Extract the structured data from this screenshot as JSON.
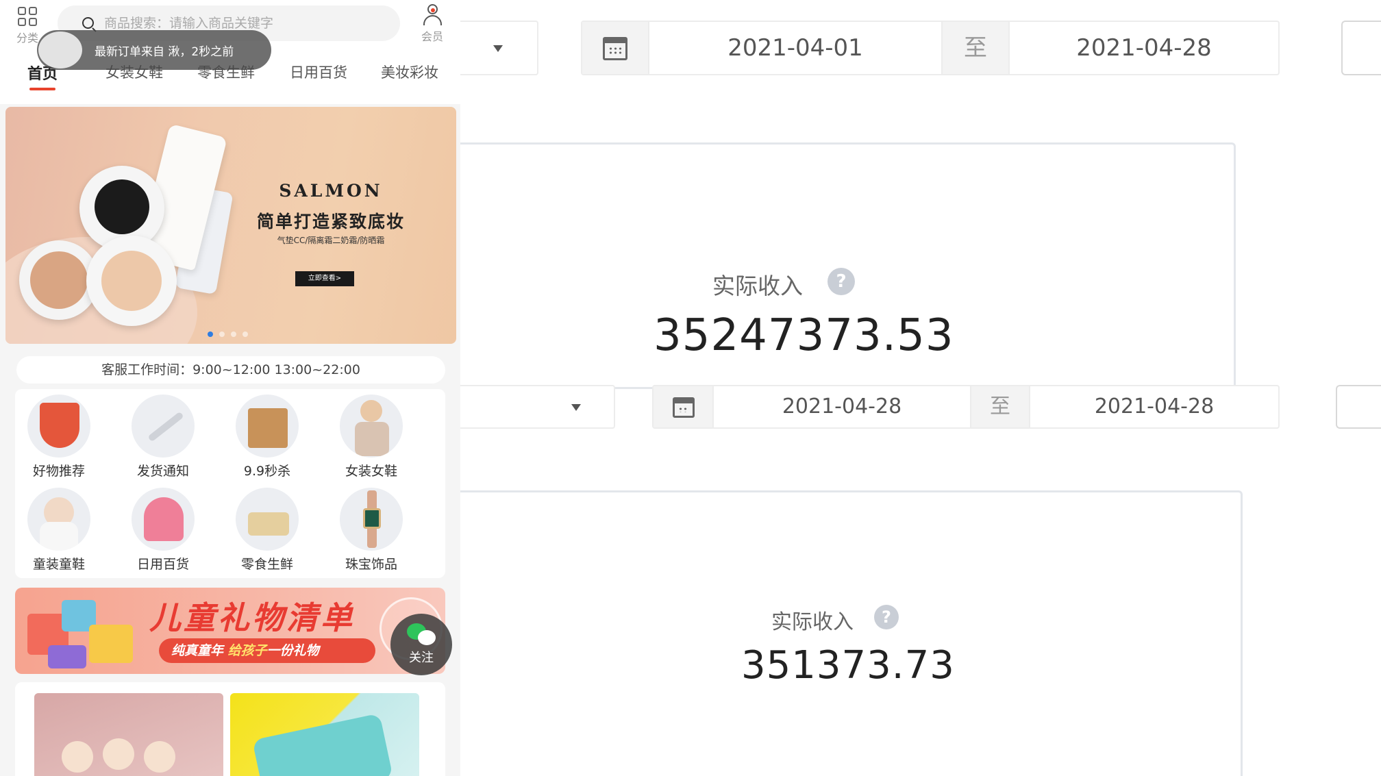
{
  "app": {
    "category_label": "分类",
    "member_label": "会员",
    "search": {
      "placeholder": "商品搜索：请输入商品关键字"
    },
    "order_toast": "最新订单来自 湫，2秒之前",
    "tabs": [
      {
        "label": "首页",
        "active": true
      },
      {
        "label": "女装女鞋",
        "active": false
      },
      {
        "label": "零食生鲜",
        "active": false
      },
      {
        "label": "日用百货",
        "active": false
      },
      {
        "label": "美妆彩妆",
        "active": false
      }
    ],
    "banner": {
      "brand": "SALMON",
      "headline": "简单打造紧致底妆",
      "subtitle": "气垫CC/隔离霜二奶霜/防晒霜",
      "cta": "立即查看>",
      "slide_count": 4,
      "active_slide": 1
    },
    "service_hours": "客服工作时间：9:00~12:00  13:00~22:00",
    "categories": [
      {
        "label": "好物推荐",
        "icon": "gift-box-icon"
      },
      {
        "label": "发货通知",
        "icon": "shipping-icon"
      },
      {
        "label": "9.9秒杀",
        "icon": "flash-sale-icon"
      },
      {
        "label": "女装女鞋",
        "icon": "womens-wear-icon"
      },
      {
        "label": "童装童鞋",
        "icon": "kids-wear-icon"
      },
      {
        "label": "日用百货",
        "icon": "umbrella-icon"
      },
      {
        "label": "零食生鲜",
        "icon": "snack-icon"
      },
      {
        "label": "珠宝饰品",
        "icon": "watch-icon"
      }
    ],
    "promo": {
      "title": "儿童礼物清单",
      "tagline_start": "纯真童年 ",
      "tagline_highlight": "给孩子",
      "tagline_end": "一份礼物"
    },
    "follow_label": "关注",
    "colors": {
      "accent": "#e8432c",
      "promo_red": "#e83b32",
      "wechat_green": "#2ec45b"
    }
  },
  "admin": {
    "panel1": {
      "date_start": "2021-04-01",
      "date_separator": "至",
      "date_end": "2021-04-28",
      "stat_label": "实际收入",
      "stat_value": "35247373.53"
    },
    "panel2": {
      "date_start": "2021-04-28",
      "date_separator": "至",
      "date_end": "2021-04-28",
      "stat_label": "实际收入",
      "stat_value": "351373.73"
    }
  }
}
